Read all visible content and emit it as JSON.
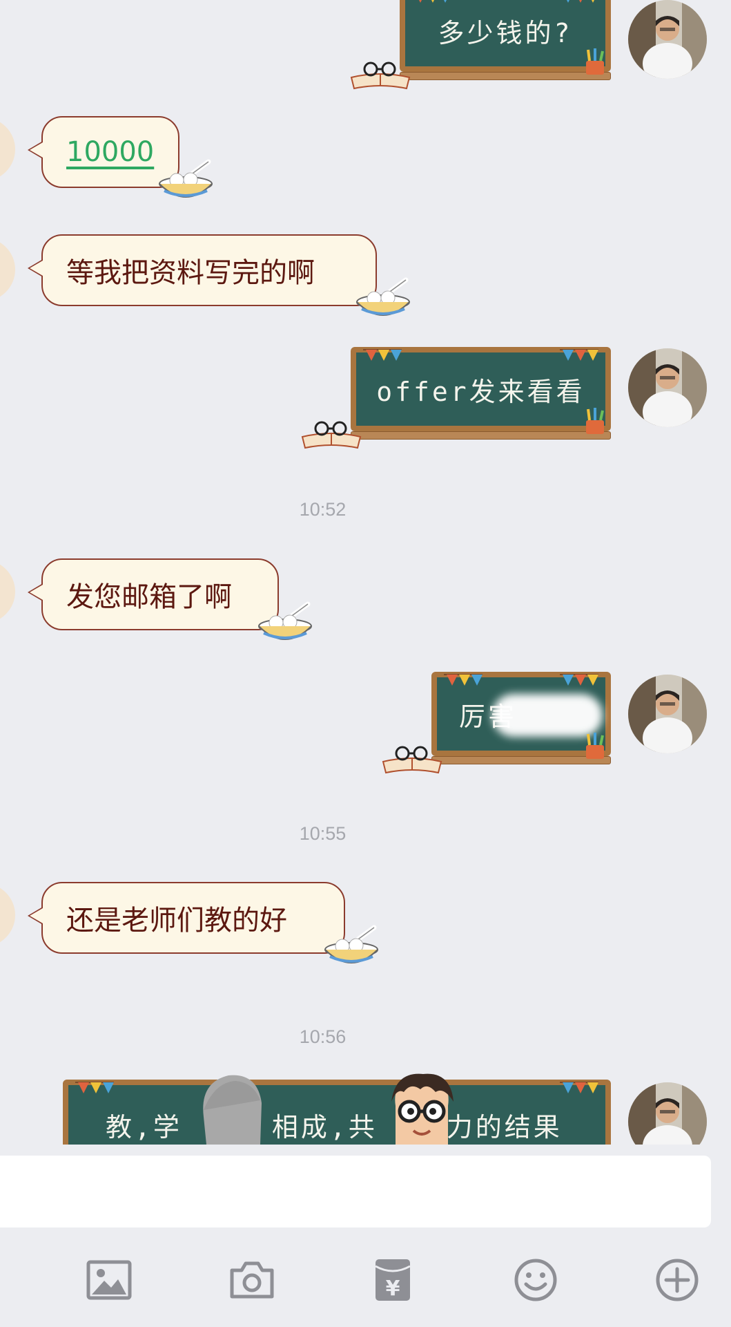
{
  "messages": [
    {
      "id": "m1",
      "direction": "outgoing",
      "text": "多少钱的?"
    },
    {
      "id": "m2",
      "direction": "incoming",
      "text": "10000",
      "is_link": true
    },
    {
      "id": "m3",
      "direction": "incoming",
      "text": "等我把资料写完的啊"
    },
    {
      "id": "m4",
      "direction": "outgoing",
      "text": "offer发来看看"
    },
    {
      "id": "t1",
      "type": "timestamp",
      "text": "10:52"
    },
    {
      "id": "m5",
      "direction": "incoming",
      "text": "发您邮箱了啊"
    },
    {
      "id": "m6",
      "direction": "outgoing",
      "text": "厉害",
      "partially_obscured": true
    },
    {
      "id": "t2",
      "type": "timestamp",
      "text": "10:55"
    },
    {
      "id": "m7",
      "direction": "incoming",
      "text": "还是老师们教的好"
    },
    {
      "id": "t3",
      "type": "timestamp",
      "text": "10:56"
    },
    {
      "id": "m8",
      "direction": "outgoing",
      "text_parts": [
        "教,学",
        "相成,共",
        "力的结果"
      ],
      "partially_obscured": true
    }
  ],
  "input": {
    "value": ""
  },
  "toolbar": [
    {
      "name": "image-icon"
    },
    {
      "name": "camera-icon"
    },
    {
      "name": "red-packet-icon",
      "glyph": "¥"
    },
    {
      "name": "emoji-icon"
    },
    {
      "name": "plus-icon"
    }
  ],
  "colors": {
    "background": "#ecedf1",
    "incoming_bubble": "#fdf7e6",
    "incoming_border": "#8b3b2d",
    "incoming_text": "#5c1810",
    "link": "#2ea861",
    "chalkboard": "#2f5e58",
    "chalkboard_frame": "#a9753f",
    "chalk_text": "#f4f4ec",
    "icon_gray": "#8e8f95"
  }
}
